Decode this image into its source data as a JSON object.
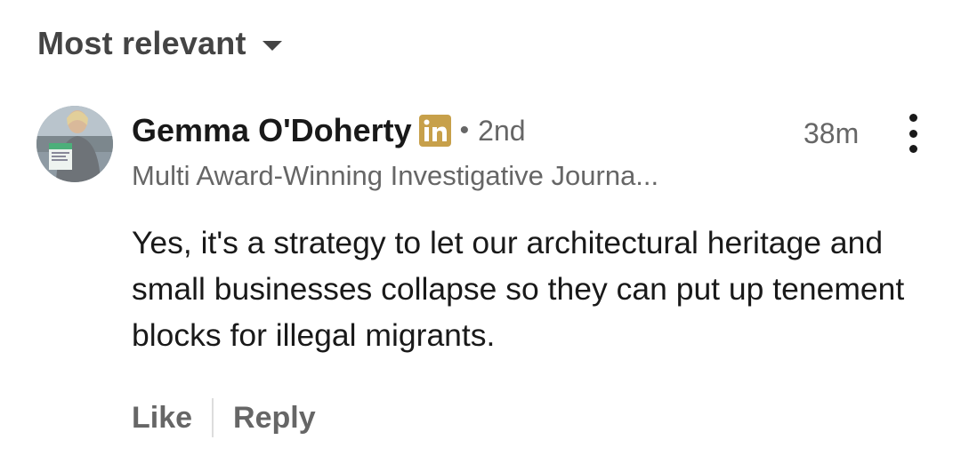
{
  "sort": {
    "label": "Most relevant"
  },
  "comment": {
    "author": "Gemma O'Doherty",
    "badge_icon": "linkedin-premium-icon",
    "connection_degree": "2nd",
    "separator": "•",
    "timestamp": "38m",
    "headline": "Multi Award-Winning Investigative Journa...",
    "text": "Yes, it's a strategy to let our architectural heritage and small businesses collapse so they can put up tenement blocks for illegal migrants.",
    "actions": {
      "like": "Like",
      "reply": "Reply"
    }
  },
  "colors": {
    "badge": "#C7A04A",
    "text_primary": "#191919",
    "text_secondary": "#666666"
  }
}
